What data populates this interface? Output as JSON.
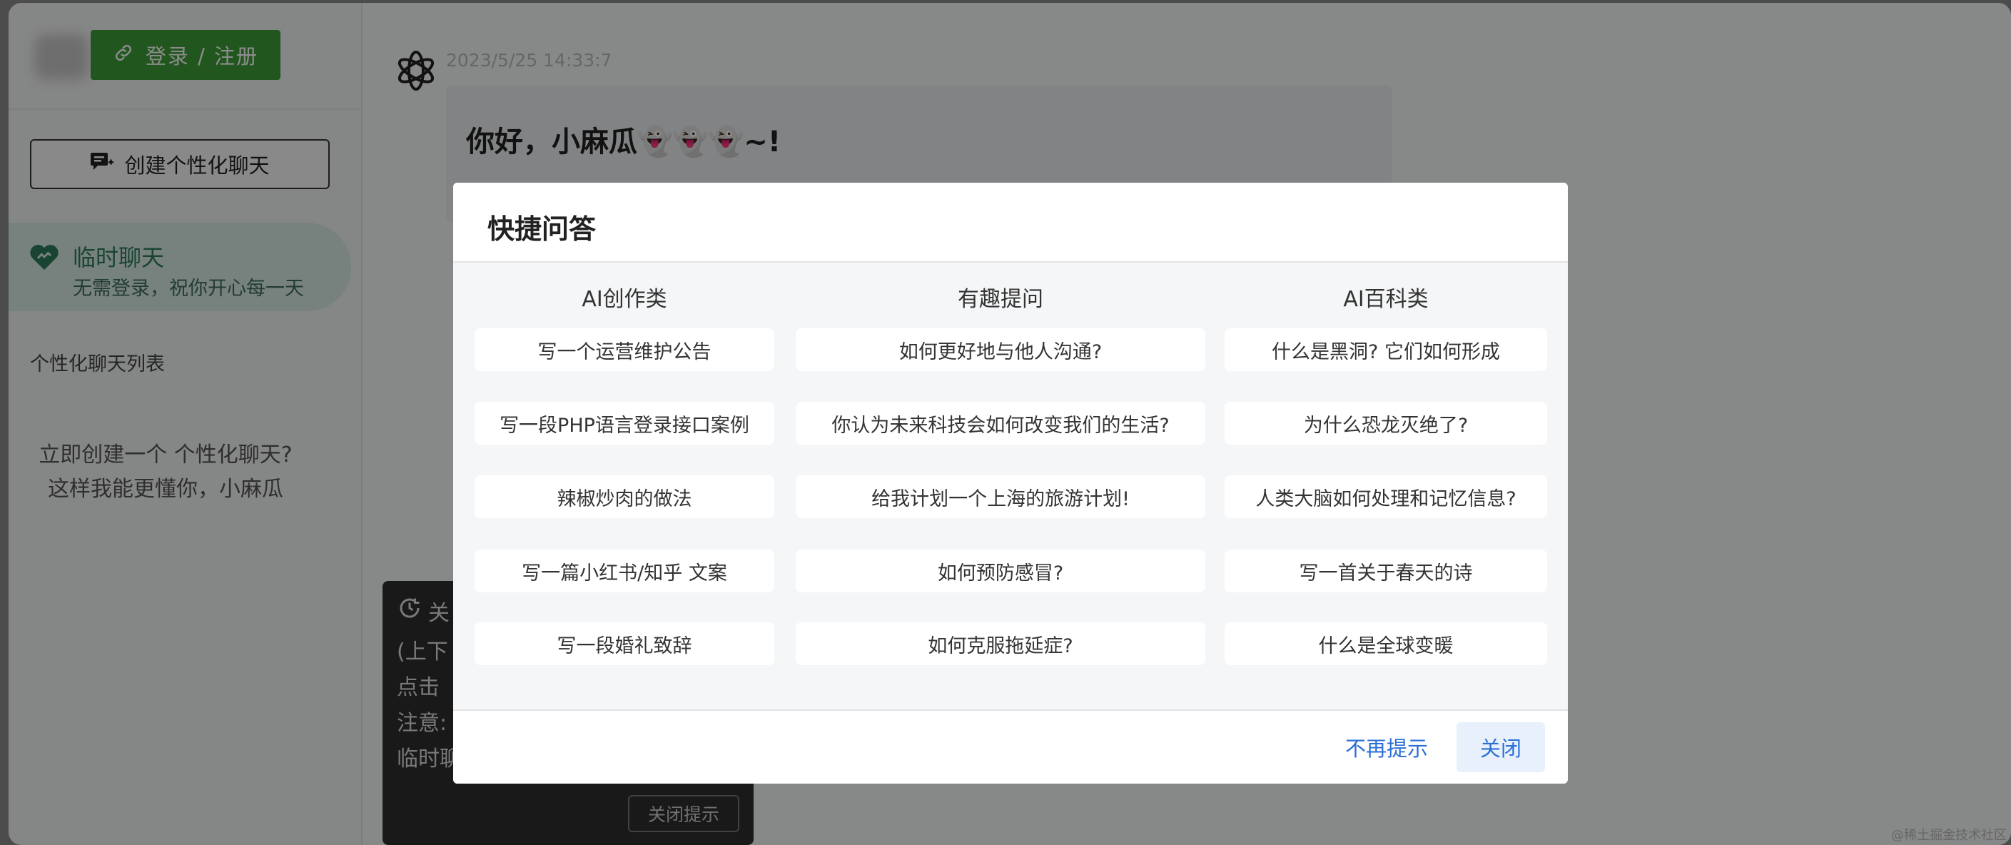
{
  "sidebar": {
    "login_label": "登录 / 注册",
    "create_label": "创建个性化聊天",
    "temp_chat": {
      "title": "临时聊天",
      "subtitle": "无需登录，祝你开心每一天"
    },
    "list_title": "个性化聊天列表",
    "empty_tip": [
      "立即创建一个 个性化聊天?",
      "这样我能更懂你，小麻瓜"
    ]
  },
  "chat": {
    "timestamp": "2023/5/25 14:33:7",
    "greeting": "你好，小麻瓜👻👻👻~!"
  },
  "tooltip": {
    "lines": [
      "关",
      "(上下",
      "点击",
      "注意:",
      "临时聊"
    ],
    "close_label": "关闭提示"
  },
  "modal": {
    "title": "快捷问答",
    "columns": [
      {
        "title": "AI创作类",
        "items": [
          "写一个运营维护公告",
          "写一段PHP语言登录接口案例",
          "辣椒炒肉的做法",
          "写一篇小红书/知乎 文案",
          "写一段婚礼致辞"
        ]
      },
      {
        "title": "有趣提问",
        "items": [
          "如何更好地与他人沟通?",
          "你认为未来科技会如何改变我们的生活?",
          "给我计划一个上海的旅游计划!",
          "如何预防感冒?",
          "如何克服拖延症?"
        ]
      },
      {
        "title": "AI百科类",
        "items": [
          "什么是黑洞? 它们如何形成",
          "为什么恐龙灭绝了?",
          "人类大脑如何处理和记忆信息?",
          "写一首关于春天的诗",
          "什么是全球变暖"
        ]
      }
    ],
    "footer": {
      "no_more_label": "不再提示",
      "close_label": "关闭"
    }
  },
  "watermark": "@稀土掘金技术社区",
  "colors": {
    "primary_green": "#3f9d3a",
    "link_blue": "#2b6fd6",
    "temp_chat_bg": "#d9ebe6"
  }
}
